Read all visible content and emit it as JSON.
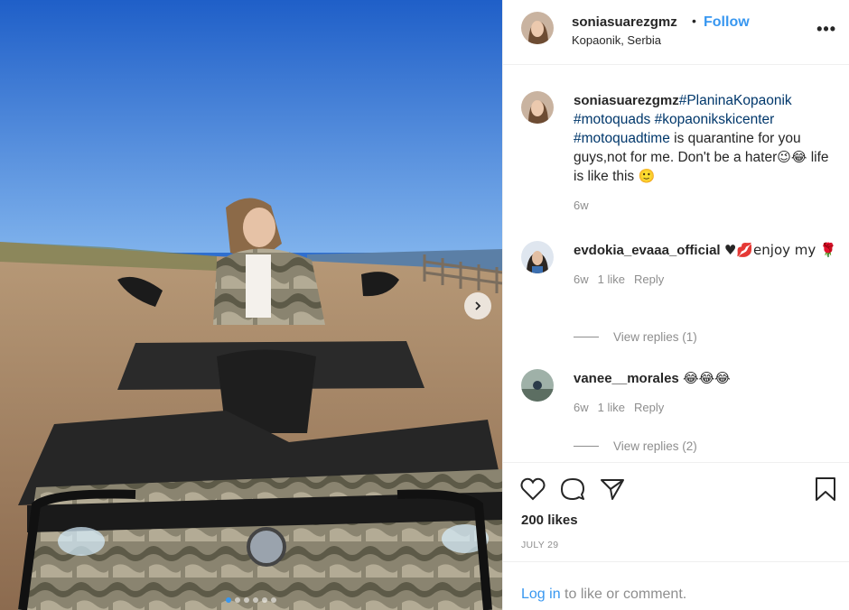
{
  "post": {
    "username": "soniasuarezgmz",
    "bullet": "•",
    "follow_label": "Follow",
    "location": "Kopaonik, Serbia",
    "more_label": "•••"
  },
  "caption": {
    "username": "soniasuarezgmz",
    "hashtags": [
      "#PlaninaKopaonik",
      "#motoquads",
      "#kopaonikskicenter",
      "#motoquadtime"
    ],
    "text": "is quarantine for you guys,not for me. Don't be a hater",
    "emoji_1": "😉😂",
    "text_2": "life is like this",
    "emoji_2": "🙂",
    "time": "6w"
  },
  "comments": [
    {
      "username": "evdokia_evaaa_official",
      "text_prefix": "♥💋enjoy my",
      "text_emoji": "🌹",
      "time": "6w",
      "likes": "1 like",
      "reply_label": "Reply",
      "view_replies": "View replies (1)"
    },
    {
      "username": "vanee__morales",
      "text_emoji": "😂😂😂",
      "time": "6w",
      "likes": "1 like",
      "reply_label": "Reply",
      "view_replies": "View replies (2)"
    }
  ],
  "actions": {
    "icons": [
      "heart-icon",
      "comment-icon",
      "share-icon",
      "bookmark-icon"
    ],
    "likes_label": "200 likes",
    "date": "JULY 29"
  },
  "login": {
    "link": "Log in",
    "rest": "to like or comment."
  },
  "carousel": {
    "slide_count": 6,
    "active_index": 0,
    "next_icon": "chevron-right-icon"
  },
  "colors": {
    "link_blue": "#3897f0",
    "hashtag_blue": "#00376b",
    "meta_gray": "#8e8e8e"
  }
}
